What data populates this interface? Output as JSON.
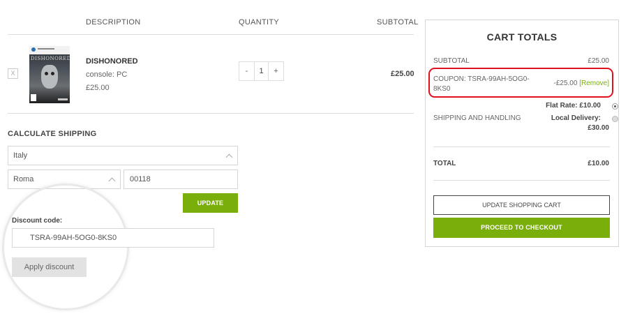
{
  "table": {
    "headers": {
      "description": "DESCRIPTION",
      "quantity": "QUANTITY",
      "subtotal": "SUBTOTAL"
    }
  },
  "cart_item": {
    "remove_label": "X",
    "cover_title": "DISHONORED",
    "name": "DISHONORED",
    "console_label": "console:",
    "console_value": "PC",
    "price": "£25.00",
    "quantity": {
      "decrement": "-",
      "value": "1",
      "increment": "+"
    },
    "subtotal": "£25.00"
  },
  "shipping": {
    "title": "CALCULATE SHIPPING",
    "country": "Italy",
    "city": "Roma",
    "postcode": "00118",
    "update_label": "UPDATE"
  },
  "discount": {
    "label": "Discount code:",
    "code": "TSRA-99AH-5OG0-8KS0",
    "apply_label": "Apply discount"
  },
  "totals": {
    "title": "CART TOTALS",
    "subtotal_label": "SUBTOTAL",
    "subtotal_value": "£25.00",
    "coupon_label_line1": "COUPON: TSRA-99AH-5OG0-",
    "coupon_label_line2": "8KS0",
    "coupon_value": "-£25.00",
    "coupon_remove": "[Remove]",
    "shipping_label": "SHIPPING AND HANDLING",
    "flat_rate": "Flat Rate: £10.00",
    "local_delivery": "Local Delivery:",
    "local_delivery_price": "£30.00",
    "total_label": "TOTAL",
    "total_value": "£10.00",
    "update_cart_label": "UPDATE SHOPPING CART",
    "checkout_label": "PROCEED TO CHECKOUT"
  },
  "colors": {
    "accent_green": "#7aae0a",
    "highlight_red": "#e0101e",
    "remove_link": "#7aae0a"
  }
}
